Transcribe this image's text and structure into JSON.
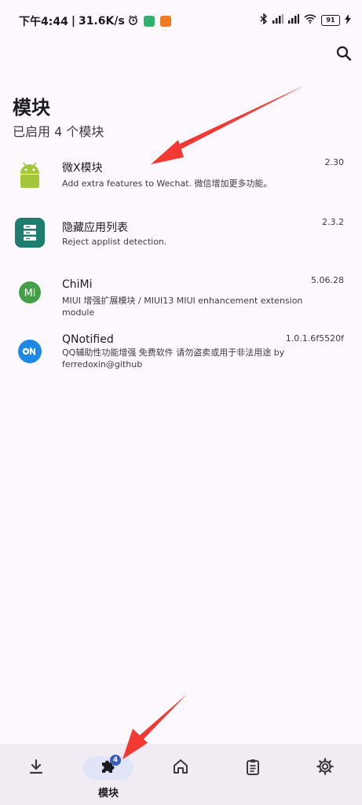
{
  "status_bar": {
    "time": "下午4:44",
    "network_speed": "31.6K/s",
    "battery": "91",
    "icons": [
      "alarm-icon",
      "shield-icon",
      "download-app-icon",
      "bluetooth-icon",
      "signal-icon",
      "signal-icon",
      "wifi-icon",
      "battery-icon",
      "charging-icon"
    ]
  },
  "header": {
    "title": "模块",
    "subtitle": "已启用 4 个模块",
    "search_icon": "search-icon"
  },
  "modules": [
    {
      "name": "微X模块",
      "description": "Add extra features to Wechat. 微信增加更多功能。",
      "version": "2.30",
      "icon": "android-icon"
    },
    {
      "name": "隐藏应用列表",
      "description": "Reject applist detection.",
      "version": "2.3.2",
      "icon": "hide-applist-icon"
    },
    {
      "name": "ChiMi",
      "description": "MIUI 增强扩展模块 / MIUI13 MIUI enhancement extension module",
      "version": "5.06.28",
      "icon": "mi-icon"
    },
    {
      "name": "QNotified",
      "description": "QQ辅助性功能增强 免费软件 请勿盗卖或用于非法用途 by ferredoxin@github",
      "version": "1.0.1.6f5520f",
      "icon": "qnotified-icon"
    }
  ],
  "bottom_nav": {
    "items": [
      {
        "icon": "download-icon",
        "label": ""
      },
      {
        "icon": "puzzle-icon",
        "label": "模块",
        "badge": "4",
        "active": true
      },
      {
        "icon": "home-icon",
        "label": ""
      },
      {
        "icon": "clipboard-icon",
        "label": ""
      },
      {
        "icon": "gear-icon",
        "label": ""
      }
    ]
  },
  "colors": {
    "background": "#fdf8fd",
    "nav_background": "#f1ecf4",
    "active_pill": "#e0e4f7",
    "badge": "#3b5bb7",
    "arrow": "#f23a32"
  }
}
